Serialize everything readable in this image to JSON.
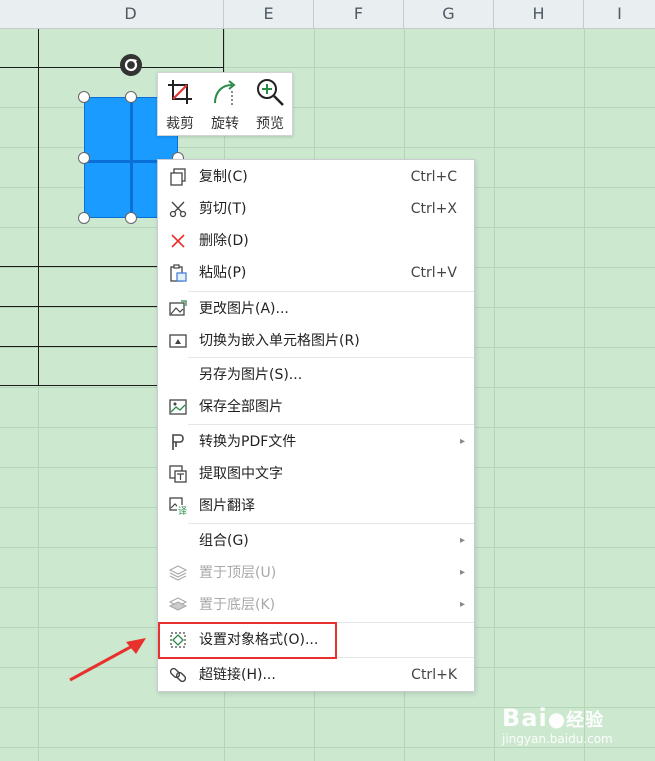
{
  "columns": [
    "D",
    "E",
    "F",
    "G",
    "H",
    "I"
  ],
  "toolbar": {
    "crop": "裁剪",
    "rotate": "旋转",
    "preview": "预览"
  },
  "menu": {
    "copy": {
      "label": "复制(C)",
      "shortcut": "Ctrl+C"
    },
    "cut": {
      "label": "剪切(T)",
      "shortcut": "Ctrl+X"
    },
    "delete": {
      "label": "删除(D)"
    },
    "paste": {
      "label": "粘贴(P)",
      "shortcut": "Ctrl+V"
    },
    "change_picture": {
      "label": "更改图片(A)..."
    },
    "embed": {
      "label": "切换为嵌入单元格图片(R)"
    },
    "save_as": {
      "label": "另存为图片(S)..."
    },
    "save_all": {
      "label": "保存全部图片"
    },
    "to_pdf": {
      "label": "转换为PDF文件"
    },
    "extract_text": {
      "label": "提取图中文字"
    },
    "translate": {
      "label": "图片翻译"
    },
    "group": {
      "label": "组合(G)"
    },
    "bring_top": {
      "label": "置于顶层(U)"
    },
    "send_bottom": {
      "label": "置于底层(K)"
    },
    "format_object": {
      "label": "设置对象格式(O)..."
    },
    "hyperlink": {
      "label": "超链接(H)...",
      "shortcut": "Ctrl+K"
    }
  },
  "watermark": {
    "brand": "Bai",
    "brand_suffix": "经验",
    "url": "jingyan.baidu.com"
  },
  "colors": {
    "sheet_bg": "#cce8cf",
    "picture": "#1a9bff",
    "highlight": "#e8302c"
  }
}
